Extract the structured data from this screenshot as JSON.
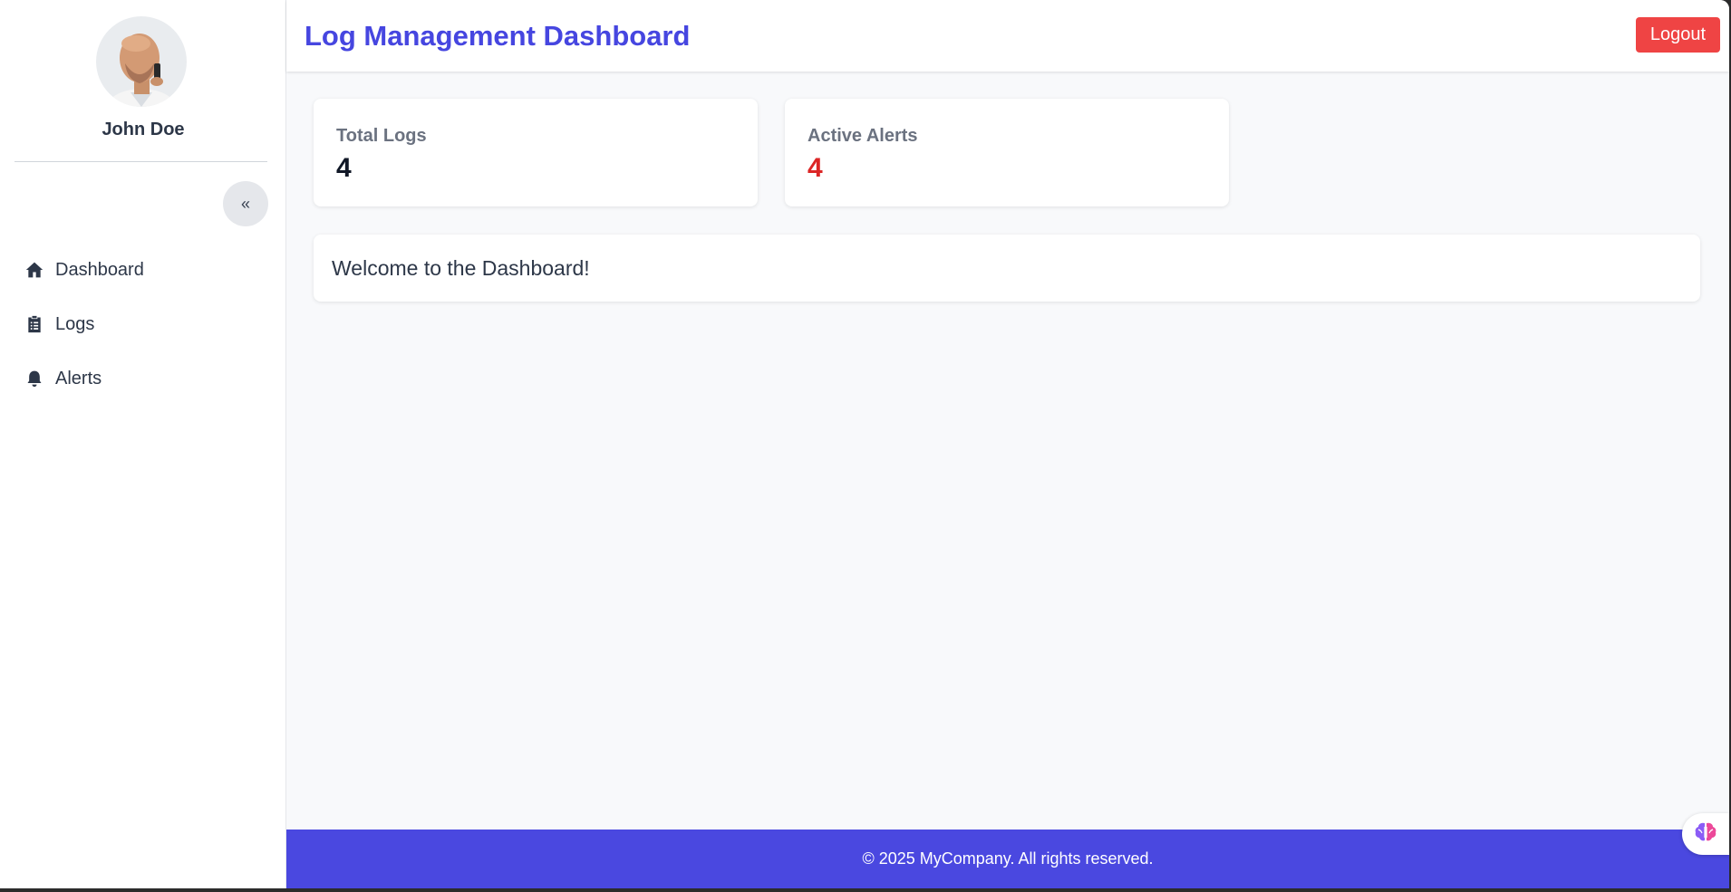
{
  "user": {
    "name": "John Doe"
  },
  "sidebar": {
    "collapse_label": "«",
    "items": [
      {
        "label": "Dashboard",
        "icon": "home-icon"
      },
      {
        "label": "Logs",
        "icon": "clipboard-icon"
      },
      {
        "label": "Alerts",
        "icon": "bell-icon"
      }
    ]
  },
  "header": {
    "title": "Log Management Dashboard",
    "logout_label": "Logout"
  },
  "stats": {
    "total_logs": {
      "label": "Total Logs",
      "value": "4"
    },
    "active_alerts": {
      "label": "Active Alerts",
      "value": "4"
    }
  },
  "main": {
    "welcome_text": "Welcome to the Dashboard!"
  },
  "footer": {
    "text": "© 2025 MyCompany. All rights reserved."
  },
  "colors": {
    "accent": "#4a48e0",
    "title": "#4646e0",
    "logout": "#ef4444",
    "alert_value": "#dc2626"
  }
}
